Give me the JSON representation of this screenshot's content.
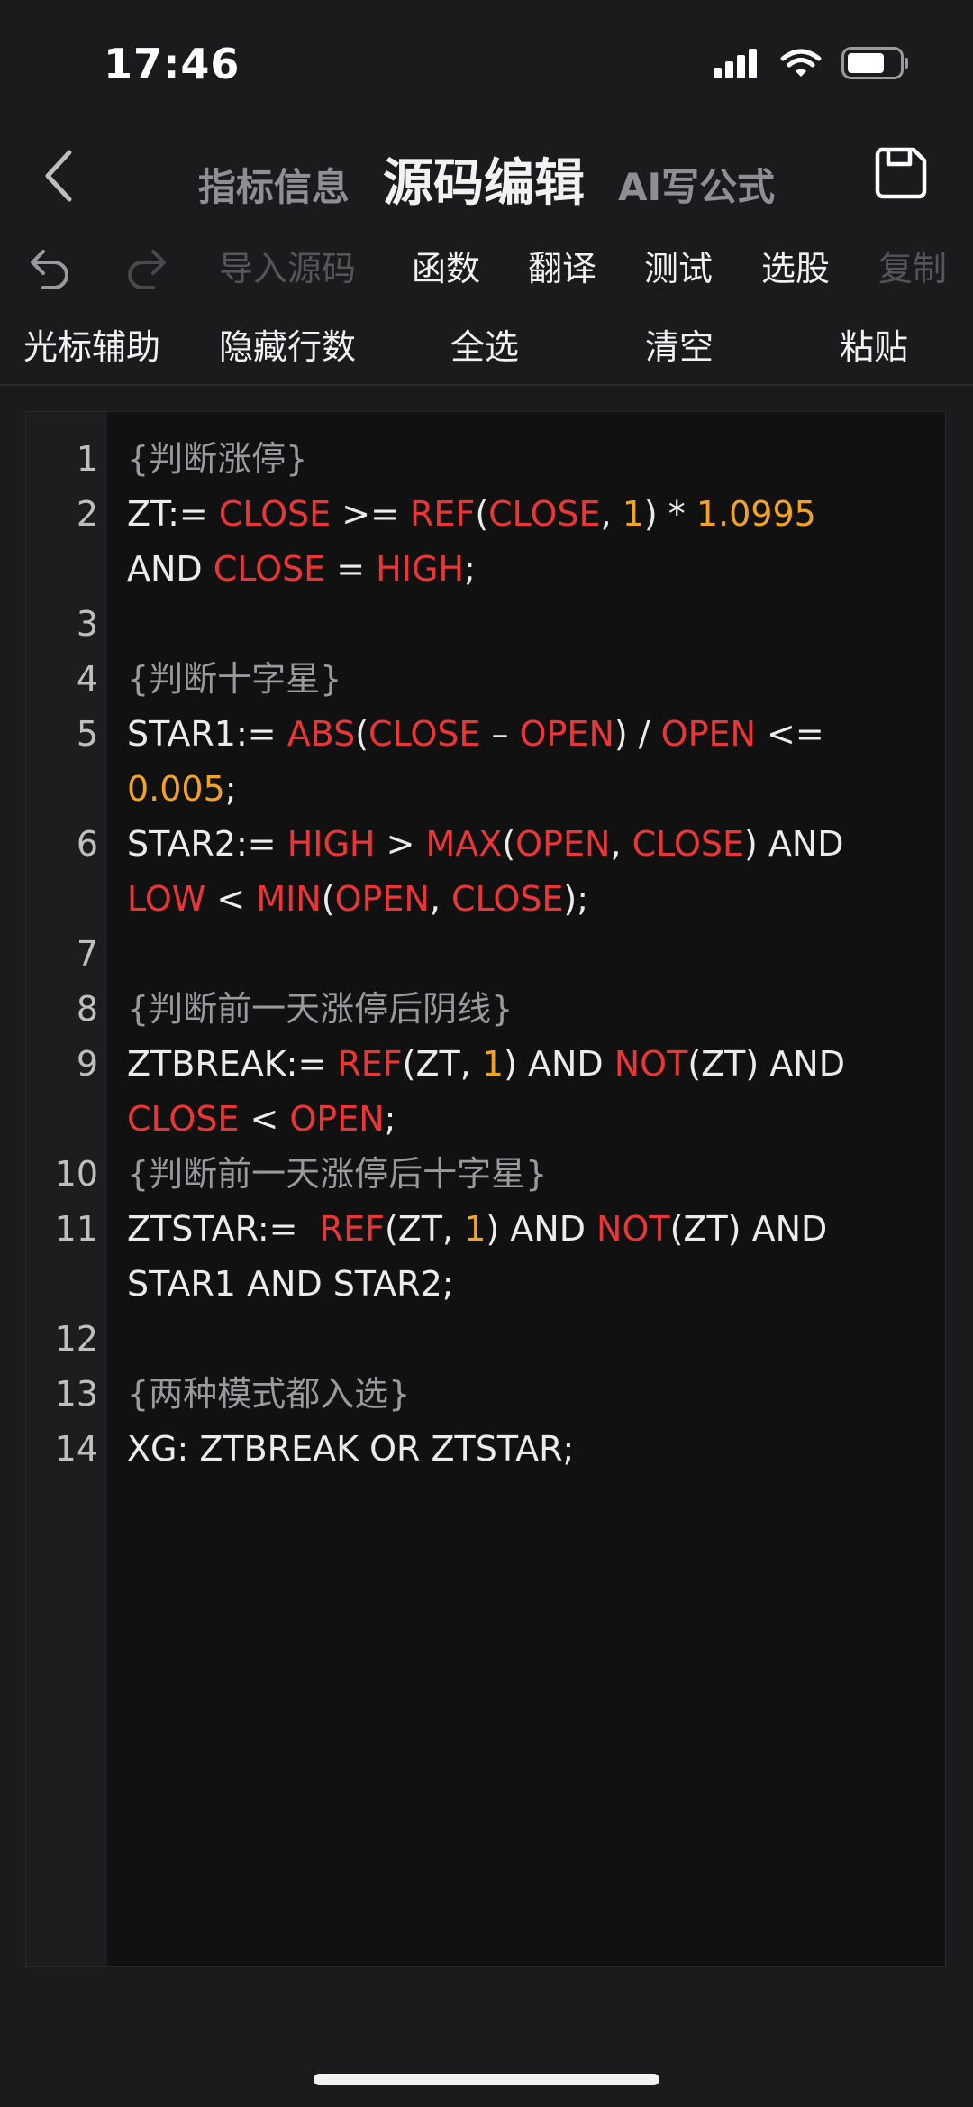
{
  "status_bar": {
    "time": "17:46"
  },
  "nav": {
    "tabs": [
      {
        "label": "指标信息",
        "active": false
      },
      {
        "label": "源码编辑",
        "active": true
      },
      {
        "label": "AI写公式",
        "active": false
      }
    ]
  },
  "toolbar1": {
    "import": "导入源码",
    "functions": "函数",
    "translate": "翻译",
    "test": "测试",
    "select_stock": "选股",
    "copy": "复制"
  },
  "toolbar2": {
    "cursor_assist": "光标辅助",
    "hide_line_numbers": "隐藏行数",
    "select_all": "全选",
    "clear": "清空",
    "paste": "粘贴"
  },
  "colors": {
    "keyword": "#ea3636",
    "number": "#f2a324",
    "comment": "#9a9a9e",
    "text": "#ececec",
    "background": "#1b1b1d"
  },
  "code": {
    "lines": [
      {
        "n": "1",
        "tokens": [
          {
            "t": "{判断涨停}",
            "c": "c"
          }
        ]
      },
      {
        "n": "2",
        "tokens": [
          {
            "t": "ZT:= "
          },
          {
            "t": "CLOSE",
            "c": "k"
          },
          {
            "t": " >= "
          },
          {
            "t": "REF",
            "c": "k"
          },
          {
            "t": "("
          },
          {
            "t": "CLOSE",
            "c": "k"
          },
          {
            "t": ", "
          },
          {
            "t": "1",
            "c": "n"
          },
          {
            "t": ") * "
          },
          {
            "t": "1.0995",
            "c": "n"
          },
          {
            "t": "\nAND "
          },
          {
            "t": "CLOSE",
            "c": "k"
          },
          {
            "t": " = "
          },
          {
            "t": "HIGH",
            "c": "k"
          },
          {
            "t": ";"
          }
        ]
      },
      {
        "n": "3",
        "tokens": []
      },
      {
        "n": "4",
        "tokens": [
          {
            "t": "{判断十字星}",
            "c": "c"
          }
        ]
      },
      {
        "n": "5",
        "tokens": [
          {
            "t": "STAR1:= "
          },
          {
            "t": "ABS",
            "c": "k"
          },
          {
            "t": "("
          },
          {
            "t": "CLOSE",
            "c": "k"
          },
          {
            "t": " – "
          },
          {
            "t": "OPEN",
            "c": "k"
          },
          {
            "t": ") / "
          },
          {
            "t": "OPEN",
            "c": "k"
          },
          {
            "t": " <=\n"
          },
          {
            "t": "0.005",
            "c": "n"
          },
          {
            "t": ";"
          }
        ]
      },
      {
        "n": "6",
        "tokens": [
          {
            "t": "STAR2:= "
          },
          {
            "t": "HIGH",
            "c": "k"
          },
          {
            "t": " > "
          },
          {
            "t": "MAX",
            "c": "k"
          },
          {
            "t": "("
          },
          {
            "t": "OPEN",
            "c": "k"
          },
          {
            "t": ", "
          },
          {
            "t": "CLOSE",
            "c": "k"
          },
          {
            "t": ") AND\n"
          },
          {
            "t": "LOW",
            "c": "k"
          },
          {
            "t": " < "
          },
          {
            "t": "MIN",
            "c": "k"
          },
          {
            "t": "("
          },
          {
            "t": "OPEN",
            "c": "k"
          },
          {
            "t": ", "
          },
          {
            "t": "CLOSE",
            "c": "k"
          },
          {
            "t": ");"
          }
        ]
      },
      {
        "n": "7",
        "tokens": []
      },
      {
        "n": "8",
        "tokens": [
          {
            "t": "{判断前一天涨停后阴线}",
            "c": "c"
          }
        ]
      },
      {
        "n": "9",
        "tokens": [
          {
            "t": "ZTBREAK:= "
          },
          {
            "t": "REF",
            "c": "k"
          },
          {
            "t": "(ZT, "
          },
          {
            "t": "1",
            "c": "n"
          },
          {
            "t": ") AND "
          },
          {
            "t": "NOT",
            "c": "k"
          },
          {
            "t": "(ZT) AND\n"
          },
          {
            "t": "CLOSE",
            "c": "k"
          },
          {
            "t": " < "
          },
          {
            "t": "OPEN",
            "c": "k"
          },
          {
            "t": ";"
          }
        ]
      },
      {
        "n": "10",
        "tokens": [
          {
            "t": "{判断前一天涨停后十字星}",
            "c": "c"
          }
        ]
      },
      {
        "n": "11",
        "tokens": [
          {
            "t": "ZTSTAR:=  "
          },
          {
            "t": "REF",
            "c": "k"
          },
          {
            "t": "(ZT, "
          },
          {
            "t": "1",
            "c": "n"
          },
          {
            "t": ") AND "
          },
          {
            "t": "NOT",
            "c": "k"
          },
          {
            "t": "(ZT) AND\nSTAR1 AND STAR2;"
          }
        ]
      },
      {
        "n": "12",
        "tokens": []
      },
      {
        "n": "13",
        "tokens": [
          {
            "t": "{两种模式都入选}",
            "c": "c"
          }
        ]
      },
      {
        "n": "14",
        "tokens": [
          {
            "t": "XG: ZTBREAK OR ZTSTAR;"
          }
        ]
      }
    ]
  }
}
